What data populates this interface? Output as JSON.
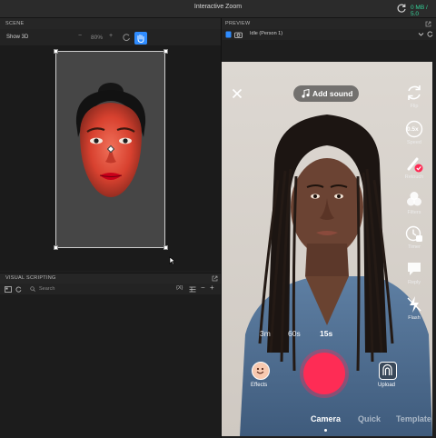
{
  "window": {
    "title": "Interactive Zoom",
    "memory": "0 MB / 5.0"
  },
  "scene": {
    "title": "SCENE",
    "show3d_label": "Show 3D",
    "zoom_level": "80%"
  },
  "visual_scripting": {
    "title": "VISUAL SCRIPTING",
    "search_placeholder": "Search",
    "x_button": "{X}"
  },
  "preview": {
    "title": "PREVIEW",
    "selected_preset": "Idle (Person 1)"
  },
  "camera_ui": {
    "add_sound": "Add sound",
    "side_tools": [
      "Flip",
      "Speed",
      "Retouch",
      "Filters",
      "Timer",
      "Reply",
      "Flash"
    ],
    "speed_value": "0.5x",
    "durations": [
      "3m",
      "60s",
      "15s"
    ],
    "effects_label": "Effects",
    "upload_label": "Upload",
    "modes": [
      "Camera",
      "Quick",
      "Template"
    ],
    "accent": "#fe2c55"
  }
}
